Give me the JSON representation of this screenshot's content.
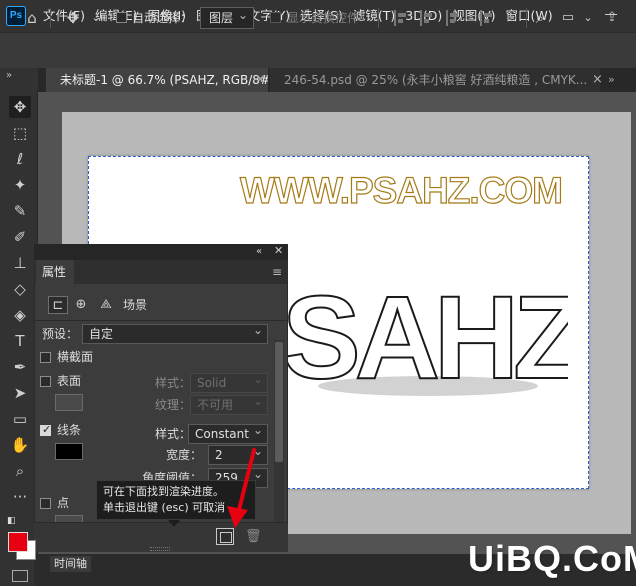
{
  "app": {
    "logo_text": "Ps",
    "menu": [
      "文件(F)",
      "编辑(E)",
      "图像(I)",
      "图层(L)",
      "文字(Y)",
      "选择(S)",
      "滤镜(T)",
      "3D(D)",
      "视图(V)",
      "窗口(W)"
    ]
  },
  "options_bar": {
    "auto_select_label": "自动选择：",
    "layer_select_value": "图层",
    "show_transform_label": "显示变换控件"
  },
  "tabs": [
    {
      "label": "未标题-1 @ 66.7% (PSAHZ, RGB/8#) *",
      "active": true
    },
    {
      "label": "246-54.psd @ 25% (永丰小粮窖 好酒纯粮造 , CMYK...",
      "active": false
    }
  ],
  "canvas": {
    "wordmark": "WWW.PSAHZ.COM",
    "art_text": "SAHZ"
  },
  "properties": {
    "title": "属性",
    "scene_label": "场景",
    "preset_label": "预设：",
    "preset_value": "自定",
    "cross_section_label": "横截面",
    "surface_label": "表面",
    "surface_style_label": "样式：",
    "surface_style_value": "Solid",
    "texture_label": "纹理：",
    "texture_value": "不可用",
    "lines_label": "线条",
    "lines_style_label": "样式：",
    "lines_style_value": "Constant",
    "width_label": "宽度：",
    "width_value": "2",
    "angle_label": "角度阈值：",
    "angle_value": "259",
    "points_label": "点"
  },
  "tooltip": {
    "line1": "可在下面找到渲染进度。",
    "line2": "单击退出键 (esc) 可取消"
  },
  "timeline": {
    "label": "时间轴"
  },
  "watermark": "UiBQ.CoM",
  "colors": {
    "foreground": "#e60012",
    "background": "#ffffff",
    "wordmark_stroke": "#a67b17",
    "annotation_arrow": "#e60012",
    "selection_marquee": "#2d5bd6"
  }
}
